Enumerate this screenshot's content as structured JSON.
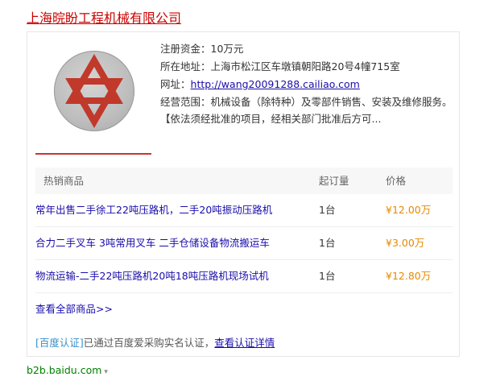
{
  "company": {
    "name": "上海晥盼工程机械有限公司"
  },
  "info": {
    "capital": "注册资金：10万元",
    "address": "所在地址：上海市松江区车墩镇朝阳路20号4幢715室",
    "website_label": "网址：",
    "website_url": "http://wang20091288.cailiao.com",
    "scope": "经营范围：机械设备（除特种）及零部件销售、安装及维修服务。【依法须经批准的项目，经相关部门批准后方可..."
  },
  "table": {
    "headers": [
      "热销商品",
      "起订量",
      "价格"
    ],
    "rows": [
      {
        "product": "常年出售二手徐工22吨压路机，二手20吨振动压路机",
        "min_order": "1台",
        "price": "¥12.00万"
      },
      {
        "product": "合力二手叉车 3吨常用叉车 二手仓储设备物流搬运车",
        "min_order": "1台",
        "price": "¥3.00万"
      },
      {
        "product": "物流运输-二手22吨压路机20吨18吨压路机现场试机",
        "min_order": "1台",
        "price": "¥12.80万"
      }
    ]
  },
  "more_link": "查看全部商品>>",
  "certification": {
    "badge": "[百度认证]",
    "text": "已通过百度爱采购实名认证，",
    "link": "查看认证详情"
  },
  "footer": {
    "domain": "b2b.baidu.com",
    "caret": "▾"
  },
  "colors": {
    "title": "#cc0000",
    "link": "#1a0dab",
    "price": "#e68a00",
    "logo_star": "#c0392b",
    "footer": "#008000"
  }
}
